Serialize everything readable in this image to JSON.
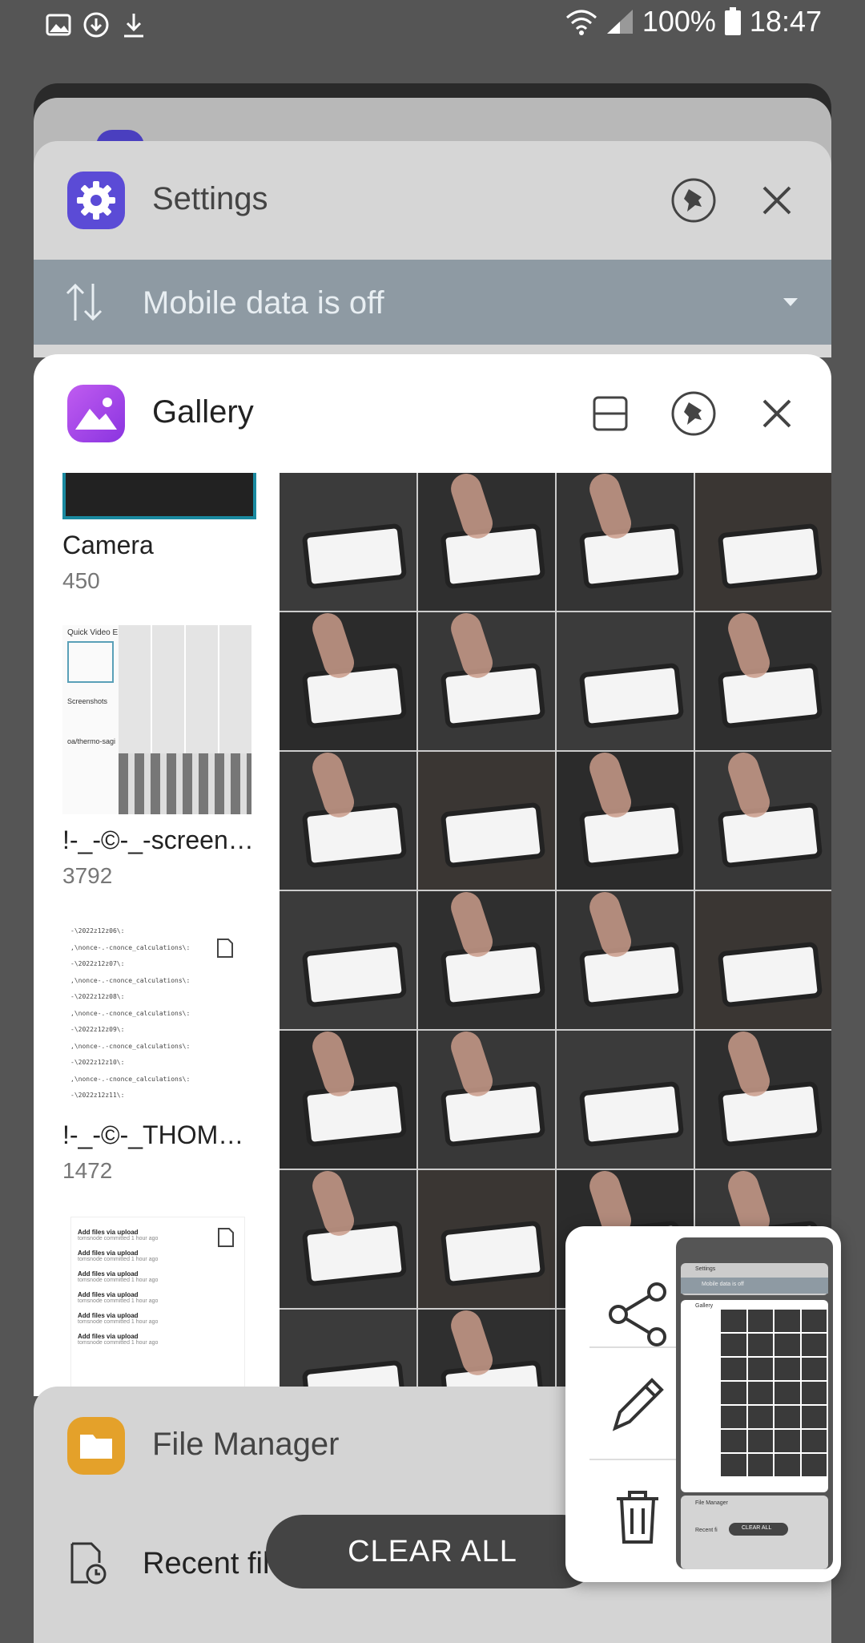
{
  "status_bar": {
    "battery": "100%",
    "time": "18:47"
  },
  "settings_card": {
    "title": "Settings",
    "notification": "Mobile data is off"
  },
  "gallery_card": {
    "title": "Gallery",
    "albums": [
      {
        "name": "Camera",
        "count": "450"
      },
      {
        "name": "!-_-©-_-screen…",
        "count": "3792"
      },
      {
        "name": "!-_-©-_THOM…",
        "count": "1472"
      }
    ],
    "album_thumb_1": {
      "line1": "Quick Video E…",
      "line2": "Screenshots",
      "line3": "oa/thermo-sagi"
    },
    "album_thumb_2_lines": [
      "-\\2022z12z06\\:",
      ",\\nonce-.-cnonce_calculations\\:",
      "-\\2022z12z07\\:",
      ",\\nonce-.-cnonce_calculations\\:",
      "-\\2022z12z08\\:",
      ",\\nonce-.-cnonce_calculations\\:",
      "-\\2022z12z09\\:",
      ",\\nonce-.-cnonce_calculations\\:",
      "-\\2022z12z10\\:",
      ",\\nonce-.-cnonce_calculations\\:",
      "-\\2022z12z11\\:"
    ],
    "album_thumb_3_lines": [
      "Add files via upload",
      "Add files via upload",
      "Add files via upload",
      "Add files via upload",
      "Add files via upload",
      "Add files via upload"
    ],
    "album_thumb_3_sub": "tomsnode committed 1 hour ago"
  },
  "file_manager_card": {
    "title": "File Manager",
    "item": "Recent files"
  },
  "clear_all_label": "CLEAR ALL",
  "mini_preview": {
    "settings": "Settings",
    "mobile_data": "Mobile data is off",
    "gallery": "Gallery",
    "file_manager": "File Manager",
    "recent": "Recent fi",
    "clear_all": "CLEAR ALL"
  },
  "colors": {
    "background": "#555555",
    "settings_icon": "#5b4bd6",
    "gallery_icon": "#a244e8",
    "file_manager_icon": "#e4a12a",
    "notification_bar": "#8e9aa3"
  },
  "icons": {
    "status_left": [
      "image-icon",
      "download-circle-icon",
      "download-icon"
    ],
    "status_right": [
      "wifi-icon",
      "signal-icon",
      "battery-icon"
    ],
    "popup_actions": [
      "share-icon",
      "edit-icon",
      "delete-icon"
    ]
  }
}
